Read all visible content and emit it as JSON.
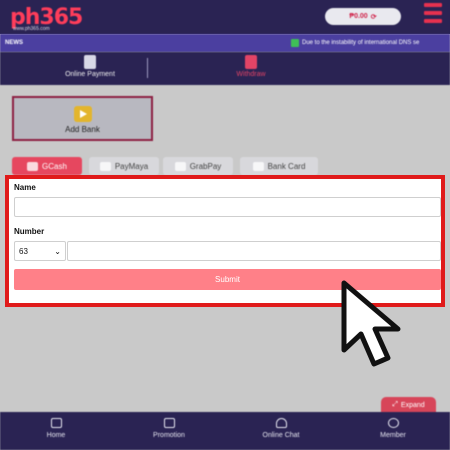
{
  "header": {
    "logo": "ph365",
    "logo_sub": "www.ph365.com",
    "balance": "₱0.00",
    "refresh_glyph": "⟳"
  },
  "news": {
    "label": "NEWS",
    "text": "Due to the instability of international DNS se"
  },
  "tabs": [
    {
      "label": "Online Payment",
      "icon": "wallet-icon"
    },
    {
      "label": "Withdraw",
      "icon": "withdraw-icon"
    }
  ],
  "add_bank": {
    "label": "Add Bank",
    "icon": "add-bank-icon"
  },
  "ewallets": [
    {
      "label": "GCash",
      "icon": "gcash-icon"
    },
    {
      "label": "PayMaya",
      "icon": "paymaya-icon"
    },
    {
      "label": "GrabPay",
      "icon": "grabpay-icon"
    },
    {
      "label": "Bank Card",
      "icon": "bank-card-icon"
    }
  ],
  "form": {
    "name_label": "Name",
    "name_value": "",
    "number_label": "Number",
    "country_code": "63",
    "number_value": "",
    "submit_label": "Submit"
  },
  "expand": {
    "label": "Expand"
  },
  "bottom_nav": [
    {
      "label": "Home",
      "icon": "home-icon"
    },
    {
      "label": "Promotion",
      "icon": "gift-icon"
    },
    {
      "label": "Online Chat",
      "icon": "headset-icon"
    },
    {
      "label": "Member",
      "icon": "user-icon"
    }
  ],
  "colors": {
    "brand_dark": "#2a2353",
    "news_bar": "#4b3fa0",
    "accent_red": "#e01a1a",
    "submit": "#ff8088",
    "gcash_tab": "#e6475f"
  }
}
